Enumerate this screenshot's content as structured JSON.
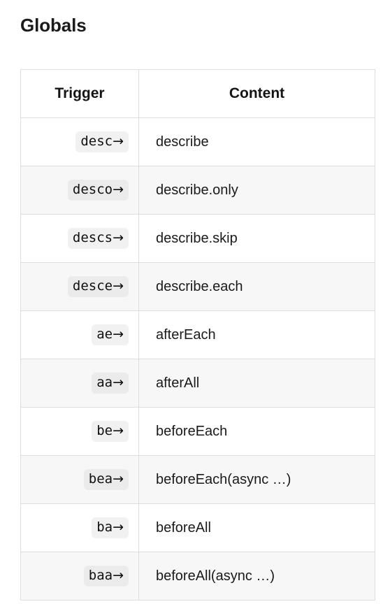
{
  "page": {
    "title": "Globals"
  },
  "table": {
    "headers": {
      "trigger": "Trigger",
      "content": "Content"
    },
    "rows": [
      {
        "trigger": "desc",
        "arrow": "→",
        "content": "describe"
      },
      {
        "trigger": "desco",
        "arrow": "→",
        "content": "describe.only"
      },
      {
        "trigger": "descs",
        "arrow": "→",
        "content": "describe.skip"
      },
      {
        "trigger": "desce",
        "arrow": "→",
        "content": "describe.each"
      },
      {
        "trigger": "ae",
        "arrow": "→",
        "content": "afterEach"
      },
      {
        "trigger": "aa",
        "arrow": "→",
        "content": "afterAll"
      },
      {
        "trigger": "be",
        "arrow": "→",
        "content": "beforeEach"
      },
      {
        "trigger": "bea",
        "arrow": "→",
        "content": "beforeEach(async …)"
      },
      {
        "trigger": "ba",
        "arrow": "→",
        "content": "beforeAll"
      },
      {
        "trigger": "baa",
        "arrow": "→",
        "content": "beforeAll(async …)"
      }
    ]
  },
  "colors": {
    "border": "#dddddd",
    "stripe": "#f7f7f7",
    "code_bg": "#f1f1f1",
    "code_bg_stripe": "#ebebeb",
    "text": "#1a1a1a"
  }
}
